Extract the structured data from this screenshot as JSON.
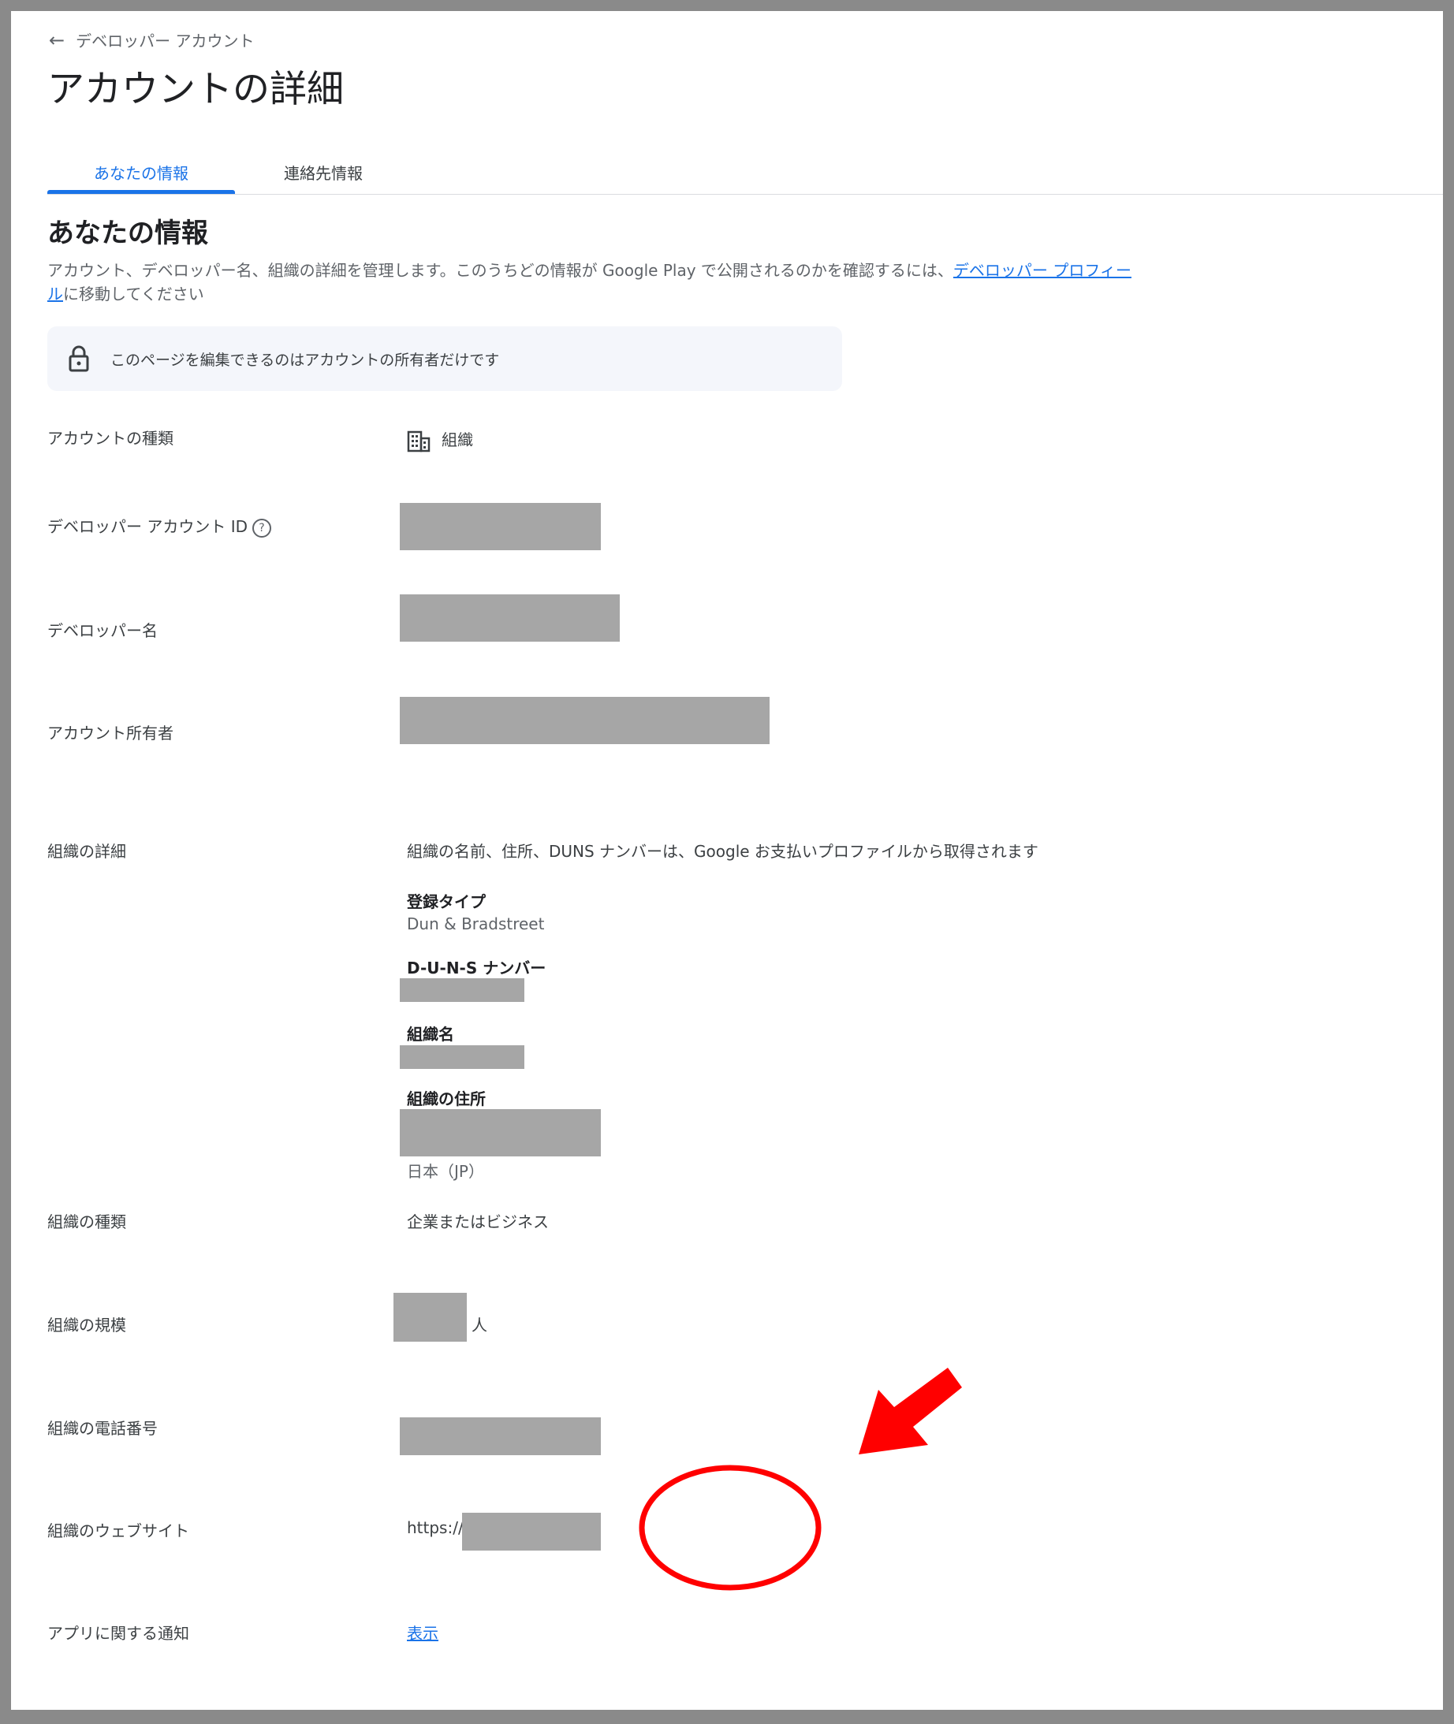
{
  "header": {
    "back_icon": "arrow-back-icon",
    "back_label": "デベロッパー アカウント",
    "title": "アカウントの詳細"
  },
  "tabs": [
    {
      "label": "あなたの情報",
      "active": true
    },
    {
      "label": "連絡先情報",
      "active": false
    }
  ],
  "section": {
    "heading": "あなたの情報",
    "description_before": "アカウント、デベロッパー名、組織の詳細を管理します。このうちどの情報が Google Play で公開されるのかを確認するには、",
    "description_link": "デベロッパー プロフィール",
    "description_after": "に移動してください"
  },
  "notice": {
    "icon": "lock-icon",
    "text": "このページを編集できるのはアカウントの所有者だけです"
  },
  "fields": {
    "account_type": {
      "label": "アカウントの種類",
      "value": "組織",
      "icon": "building-icon"
    },
    "developer_id": {
      "label": "デベロッパー アカウント ID",
      "help_icon": "help-circle-icon"
    },
    "developer_name": {
      "label": "デベロッパー名"
    },
    "account_owner": {
      "label": "アカウント所有者"
    },
    "org_details": {
      "label": "組織の詳細",
      "note": "組織の名前、住所、DUNS ナンバーは、Google お支払いプロファイルから取得されます",
      "registration_type_label": "登録タイプ",
      "registration_type_value": "Dun & Bradstreet",
      "duns_label": "D-U-N-S ナンバー",
      "org_name_label": "組織名",
      "org_address_label": "組織の住所",
      "country": "日本（JP）"
    },
    "org_type": {
      "label": "組織の種類",
      "value": "企業またはビジネス"
    },
    "org_size": {
      "label": "組織の規模",
      "suffix": "人"
    },
    "org_phone": {
      "label": "組織の電話番号"
    },
    "org_website": {
      "label": "組織のウェブサイト",
      "prefix": "https://"
    },
    "app_notifications": {
      "label": "アプリに関する通知",
      "link": "表示"
    }
  },
  "colors": {
    "accent": "#1a73e8",
    "redaction": "#a6a6a6",
    "annotation": "#ff0000"
  }
}
